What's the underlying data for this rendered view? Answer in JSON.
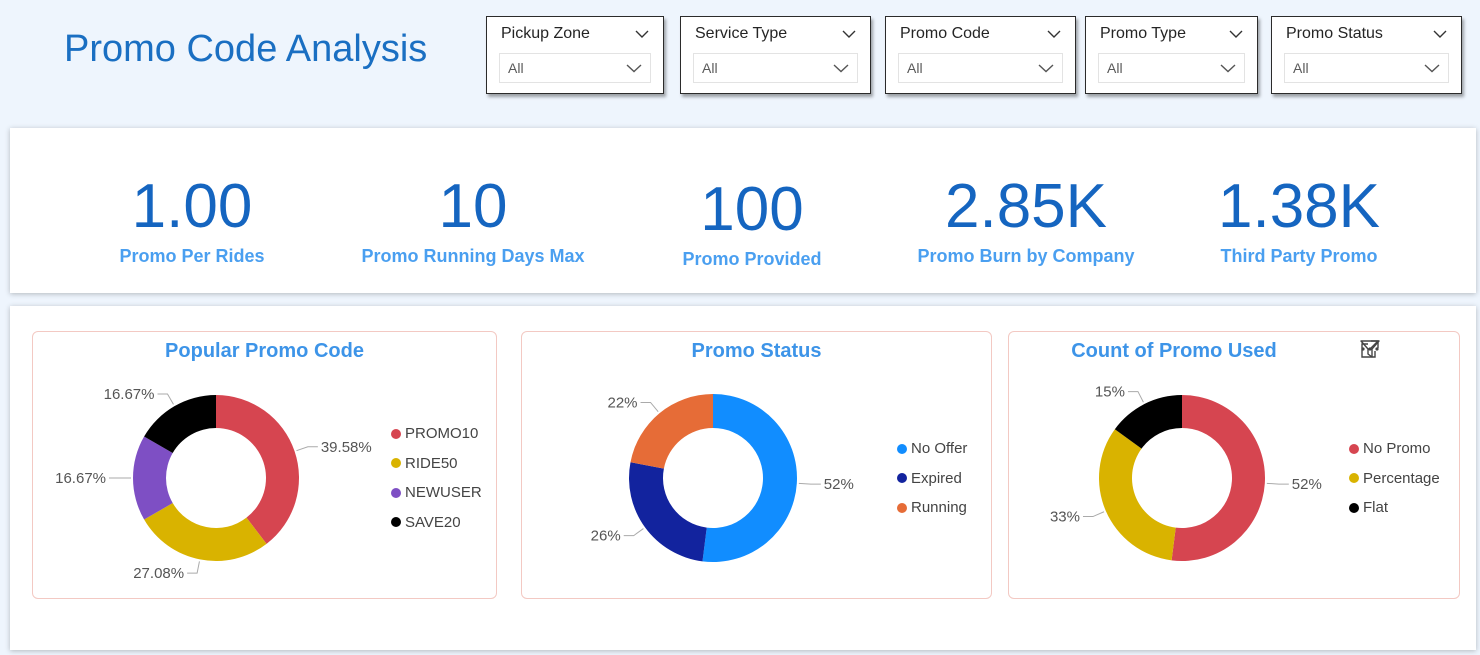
{
  "page_title": "Promo Code Analysis",
  "slicers": [
    {
      "label": "Pickup Zone",
      "value": "All"
    },
    {
      "label": "Service Type",
      "value": "All"
    },
    {
      "label": "Promo Code",
      "value": "All"
    },
    {
      "label": "Promo Type",
      "value": "All"
    },
    {
      "label": "Promo Status",
      "value": "All"
    }
  ],
  "kpis": [
    {
      "value": "1.00",
      "label": "Promo Per Rides"
    },
    {
      "value": "10",
      "label": "Promo Running Days Max"
    },
    {
      "value": "100",
      "label": "Promo Provided"
    },
    {
      "value": "2.85K",
      "label": "Promo Burn by Company"
    },
    {
      "value": "1.38K",
      "label": "Third Party Promo"
    }
  ],
  "visual_actions": [
    "filter-icon",
    "focus-mode-icon",
    "more-options-icon"
  ],
  "chart_data": [
    {
      "type": "pie",
      "title": "Popular Promo Code",
      "categories": [
        "PROMO10",
        "RIDE50",
        "NEWUSER",
        "SAVE20"
      ],
      "values": [
        39.58,
        27.08,
        16.67,
        16.67
      ],
      "labels": [
        "39.58%",
        "27.08%",
        "16.67%",
        "16.67%"
      ],
      "colors": [
        "#d64550",
        "#d9b300",
        "#7e4fc4",
        "#000000"
      ],
      "legend_position": "right"
    },
    {
      "type": "pie",
      "title": "Promo Status",
      "categories": [
        "No Offer",
        "Expired",
        "Running"
      ],
      "values": [
        52,
        26,
        22
      ],
      "labels": [
        "52%",
        "26%",
        "22%"
      ],
      "colors": [
        "#118dff",
        "#12239e",
        "#e66c37"
      ],
      "legend_position": "right"
    },
    {
      "type": "pie",
      "title": "Count of Promo Used",
      "categories": [
        "No Promo",
        "Percentage",
        "Flat"
      ],
      "values": [
        52,
        33,
        15
      ],
      "labels": [
        "52%",
        "33%",
        "15%"
      ],
      "colors": [
        "#d64550",
        "#d9b300",
        "#000000"
      ],
      "legend_position": "right"
    }
  ]
}
